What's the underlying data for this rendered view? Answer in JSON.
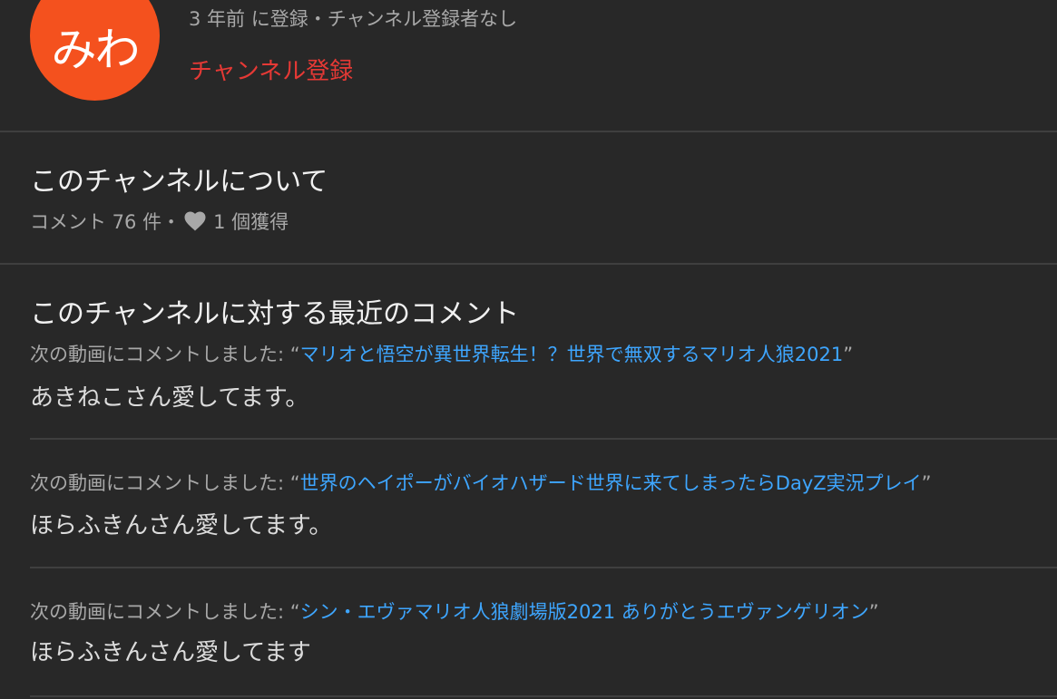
{
  "channel": {
    "avatar_text": "みわ",
    "avatar_color": "#f4511e",
    "meta": "3 年前 に登録・チャンネル登録者なし",
    "subscribe_label": "チャンネル登録"
  },
  "about": {
    "title": "このチャンネルについて",
    "comment_count": "コメント 76 件・",
    "likes_icon": "heart-icon",
    "likes_received": "1 個獲得"
  },
  "recent_comments": {
    "title": "このチャンネルに対する最近のコメント",
    "items": [
      {
        "prefix": "次の動画にコメントしました: “",
        "video_title": "マリオと悟空が異世界転生！？世界で無双するマリオ人狼2021",
        "suffix": "”",
        "text": "あきねこさん愛してます。"
      },
      {
        "prefix": "次の動画にコメントしました: “",
        "video_title": "世界のヘイポーがバイオハザード世界に来てしまったらDayZ実況プレイ",
        "suffix": "”",
        "text": "ほらふきんさん愛してます。"
      },
      {
        "prefix": "次の動画にコメントしました: “",
        "video_title": "シン・エヴァマリオ人狼劇場版2021 ありがとうエヴァンゲリオン",
        "suffix": "”",
        "text": "ほらふきんさん愛してます"
      }
    ]
  },
  "colors": {
    "background": "#282828",
    "accent_red": "#e53935",
    "link_blue": "#3ea6ff"
  }
}
